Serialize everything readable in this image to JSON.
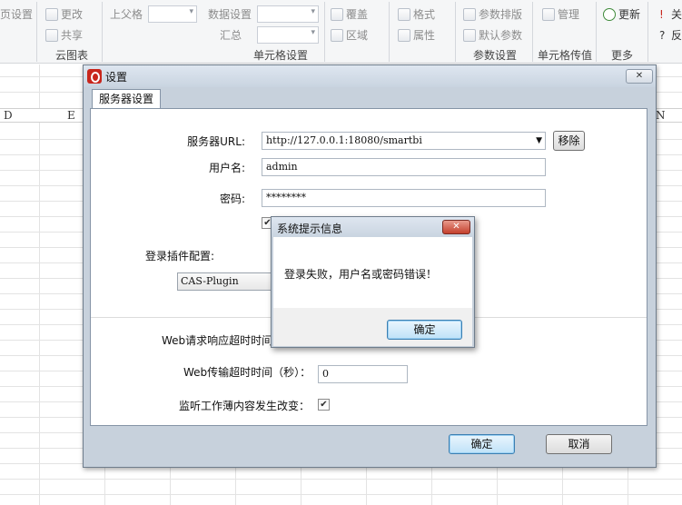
{
  "ribbon": {
    "row1": {
      "page_settings": "页设置",
      "change": "更改",
      "parent": "上父格",
      "data_settings": "数据设置",
      "cover": "覆盖",
      "format": "格式",
      "param_layout": "参数排版",
      "manage": "管理",
      "refresh": "更新",
      "close": "关"
    },
    "row2": {
      "share": "共享",
      "summary": "汇总",
      "region": "区域",
      "property": "属性",
      "default_param": "默认参数",
      "reverse": "反"
    },
    "groups": {
      "cloud_chart": "云图表",
      "cell_settings": "单元格设置",
      "param_settings": "参数设置",
      "cell_pass": "单元格传值",
      "more": "更多"
    }
  },
  "sheet": {
    "column_headers": [
      "D",
      "E",
      "N"
    ]
  },
  "settings_dialog": {
    "title": "设置",
    "close_label": "✕",
    "tab": "服务器设置",
    "server_url_label": "服务器URL:",
    "server_url_value": "http://127.0.0.1:18080/smartbi",
    "remove_button": "移除",
    "username_label": "用户名:",
    "username_value": "admin",
    "password_label": "密码:",
    "password_value": "********",
    "remember_checked": true,
    "login_plugin_label": "登录插件配置:",
    "login_plugin_value": "CAS-Plugin",
    "web_timeout_label": "Web请求响应超时时间",
    "transfer_timeout_label": "Web传输超时时间（秒）：",
    "transfer_timeout_value": "0",
    "monitor_label": "监听工作薄内容发生改变：",
    "monitor_checked": true,
    "ok_button": "确定",
    "cancel_button": "取消"
  },
  "alert_dialog": {
    "title": "系统提示信息",
    "close_label": "✕",
    "message": "登录失败，用户名或密码错误！",
    "ok_button": "确定"
  },
  "colors": {
    "brand_red": "#c8261c",
    "dialog_frame": "#c7d1dc",
    "default_button": "#bfe2f8"
  }
}
